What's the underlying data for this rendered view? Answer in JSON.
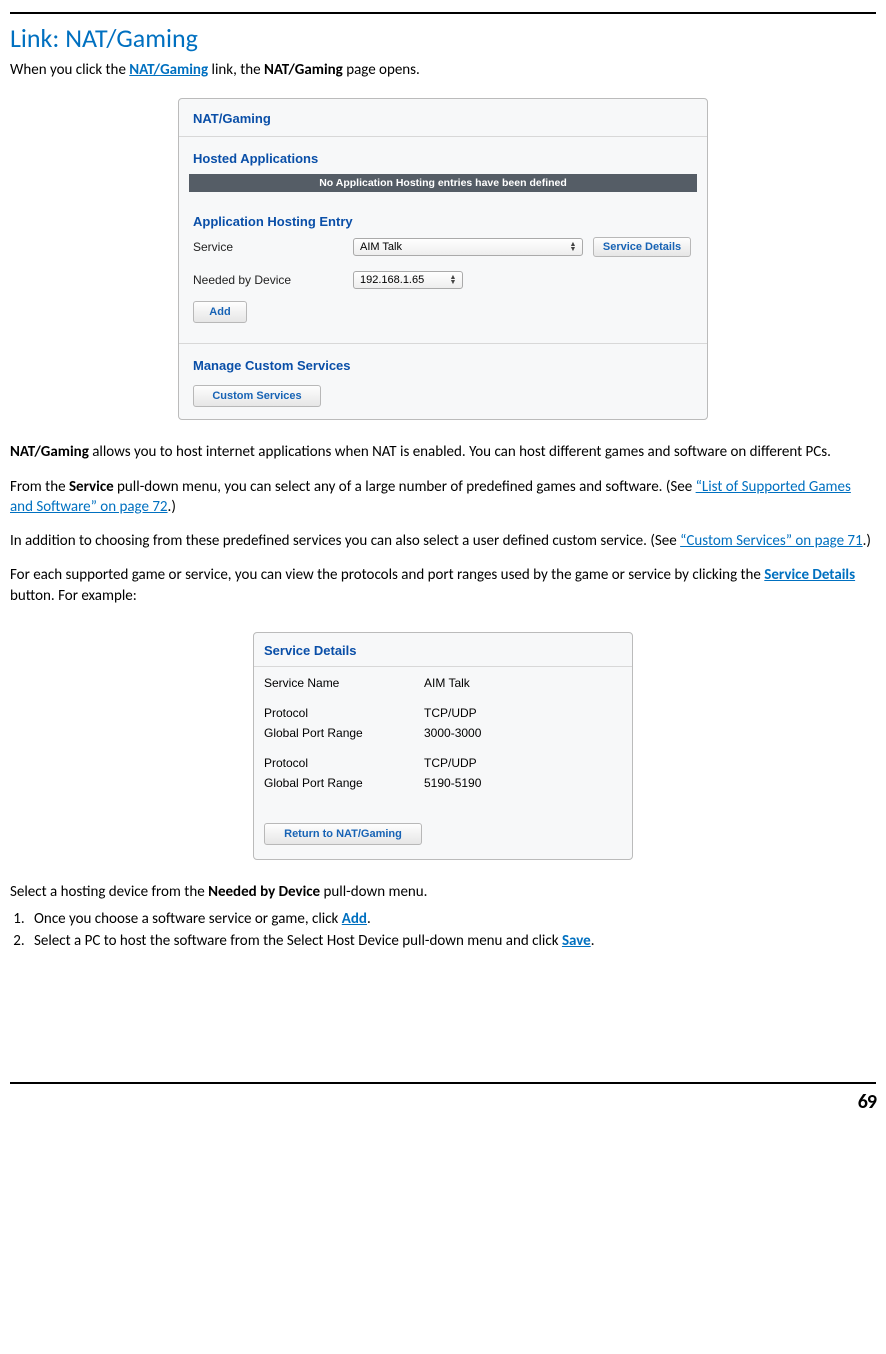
{
  "title": {
    "prefix": "Link: ",
    "name": "NAT/Gaming"
  },
  "intro": {
    "t1": "When you click the ",
    "link1": "NAT/Gaming",
    "t2": " link, the ",
    "bold1": "NAT/Gaming",
    "t3": " page opens."
  },
  "panel1": {
    "heading": "NAT/Gaming",
    "hosted_title": "Hosted Applications",
    "no_entries": "No Application Hosting entries have been defined",
    "entry_title": "Application Hosting Entry",
    "service_label": "Service",
    "service_value": "AIM Talk",
    "service_details_btn": "Service Details",
    "needed_label": "Needed by Device",
    "needed_value": "192.168.1.65",
    "add_btn": "Add",
    "manage_title": "Manage Custom Services",
    "custom_btn": "Custom Services"
  },
  "para1": {
    "b1": "NAT/Gaming",
    "t1": " allows you to host internet applications when NAT is enabled. You can host different games and software on different PCs."
  },
  "para2": {
    "t1": "From the ",
    "b1": "Service",
    "t2": " pull-down menu, you can select any of a large number of predefined games and software. (See ",
    "link1": "“List of Supported Games and Software” on page 72",
    "t3": ".)"
  },
  "para3": {
    "t1": "In addition to choosing from these predefined services you can also select a user defined custom service. (See ",
    "link1": "“Custom Services” on page 71",
    "t2": ".)"
  },
  "para4": {
    "t1": "For each supported game or service, you can view the protocols and port ranges used by the game or service by clicking the ",
    "link1": "Service Details",
    "t2": " button. For example:"
  },
  "panel2": {
    "heading": "Service Details",
    "rows": [
      {
        "label": "Service Name",
        "value": "AIM Talk"
      },
      {
        "label": "",
        "value": ""
      },
      {
        "label": "Protocol",
        "value": "TCP/UDP"
      },
      {
        "label": "Global Port Range",
        "value": "3000-3000"
      },
      {
        "label": "",
        "value": ""
      },
      {
        "label": "Protocol",
        "value": "TCP/UDP"
      },
      {
        "label": "Global Port Range",
        "value": "5190-5190"
      }
    ],
    "return_btn": "Return to NAT/Gaming"
  },
  "para5": {
    "t1": "Select a hosting device from the ",
    "b1": "Needed by Device",
    "t2": " pull-down menu."
  },
  "steps": {
    "s1a": "Once you choose a software service or game, click ",
    "s1link": "Add",
    "s1b": ".",
    "s2a": "Select a PC to host the software from the Select Host Device pull-down menu and click ",
    "s2link": "Save",
    "s2b": "."
  },
  "page_number": "69"
}
